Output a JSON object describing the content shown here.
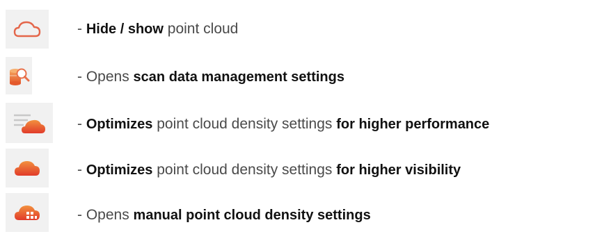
{
  "colors": {
    "icon_orange": "#f08040",
    "icon_red": "#e0422c",
    "icon_outline": "#e4664a",
    "text": "#4a4a4a",
    "bold_text": "#111111",
    "icon_background": "#f1f1f1"
  },
  "legend": [
    {
      "icon": "cloud-outline-icon",
      "dash": "- ",
      "parts": [
        {
          "text": "Hide / show",
          "bold": true
        },
        {
          "text": " point cloud",
          "bold": false
        }
      ]
    },
    {
      "icon": "scan-data-search-icon",
      "dash": "- ",
      "parts": [
        {
          "text": "Opens ",
          "bold": false
        },
        {
          "text": "scan data management settings",
          "bold": true
        }
      ]
    },
    {
      "icon": "cloud-performance-icon",
      "dash": "- ",
      "parts": [
        {
          "text": "Optimizes",
          "bold": true
        },
        {
          "text": " point cloud density settings ",
          "bold": false
        },
        {
          "text": "for higher performance",
          "bold": true
        }
      ]
    },
    {
      "icon": "cloud-filled-icon",
      "dash": "- ",
      "parts": [
        {
          "text": "Optimizes",
          "bold": true
        },
        {
          "text": " point cloud density settings ",
          "bold": false
        },
        {
          "text": "for higher visibility",
          "bold": true
        }
      ]
    },
    {
      "icon": "cloud-density-grid-icon",
      "dash": "- ",
      "parts": [
        {
          "text": "Opens ",
          "bold": false
        },
        {
          "text": "manual point cloud density settings",
          "bold": true
        }
      ]
    }
  ]
}
